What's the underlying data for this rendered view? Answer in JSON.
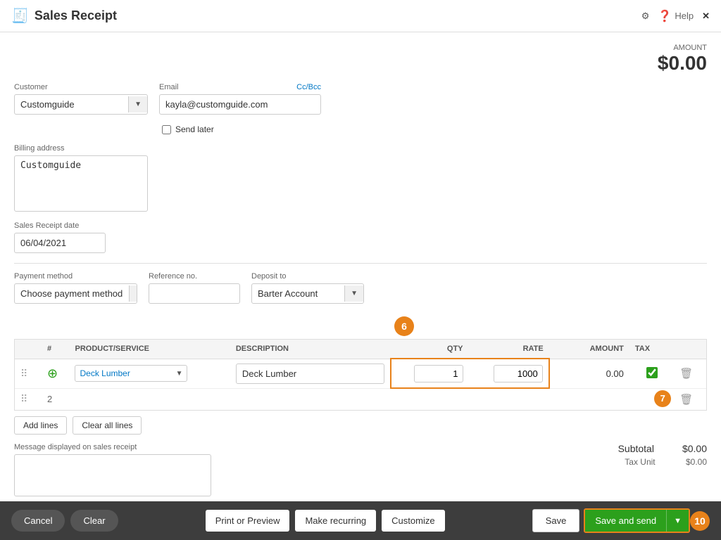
{
  "titleBar": {
    "title": "Sales Receipt",
    "settings_icon": "⚙",
    "help_label": "Help",
    "close_icon": "✕"
  },
  "amount": {
    "label": "AMOUNT",
    "value": "$0.00"
  },
  "form": {
    "customer_label": "Customer",
    "customer_value": "Customguide",
    "email_label": "Email",
    "email_value": "kayla@customguide.com",
    "ccbcc_label": "Cc/Bcc",
    "send_later_label": "Send later",
    "billing_address_label": "Billing address",
    "billing_address_value": "Customguide",
    "sales_receipt_date_label": "Sales Receipt date",
    "sales_receipt_date_value": "06/04/2021",
    "payment_method_label": "Payment method",
    "payment_method_placeholder": "Choose payment method",
    "reference_no_label": "Reference no.",
    "reference_no_value": "",
    "deposit_to_label": "Deposit to",
    "deposit_to_value": "Barter Account"
  },
  "table": {
    "headers": {
      "hash": "#",
      "product": "PRODUCT/SERVICE",
      "description": "DESCRIPTION",
      "qty": "QTY",
      "rate": "RATE",
      "amount": "AMOUNT",
      "tax": "TAX"
    },
    "rows": [
      {
        "num": "1",
        "product": "Deck Lumber",
        "description": "Deck Lumber",
        "qty": "1",
        "rate": "1000",
        "amount": "0.00",
        "tax_checked": true
      },
      {
        "num": "2",
        "product": "",
        "description": "",
        "qty": "",
        "rate": "",
        "amount": "",
        "tax_checked": false
      }
    ],
    "add_lines_label": "Add lines",
    "clear_all_lines_label": "Clear all lines"
  },
  "steps": {
    "step6_label": "6",
    "step7_label": "7",
    "step10_label": "10"
  },
  "footer": {
    "message_label": "Message displayed on sales receipt",
    "message_value": "",
    "subtotal_label": "Subtotal",
    "subtotal_value": "$0.00",
    "tax_unit_label": "Tax Unit",
    "tax_unit_value": "$0.00"
  },
  "bottomBar": {
    "cancel_label": "Cancel",
    "clear_label": "Clear",
    "print_preview_label": "Print or Preview",
    "make_recurring_label": "Make recurring",
    "customize_label": "Customize",
    "save_label": "Save",
    "save_and_send_label": "Save and send"
  }
}
